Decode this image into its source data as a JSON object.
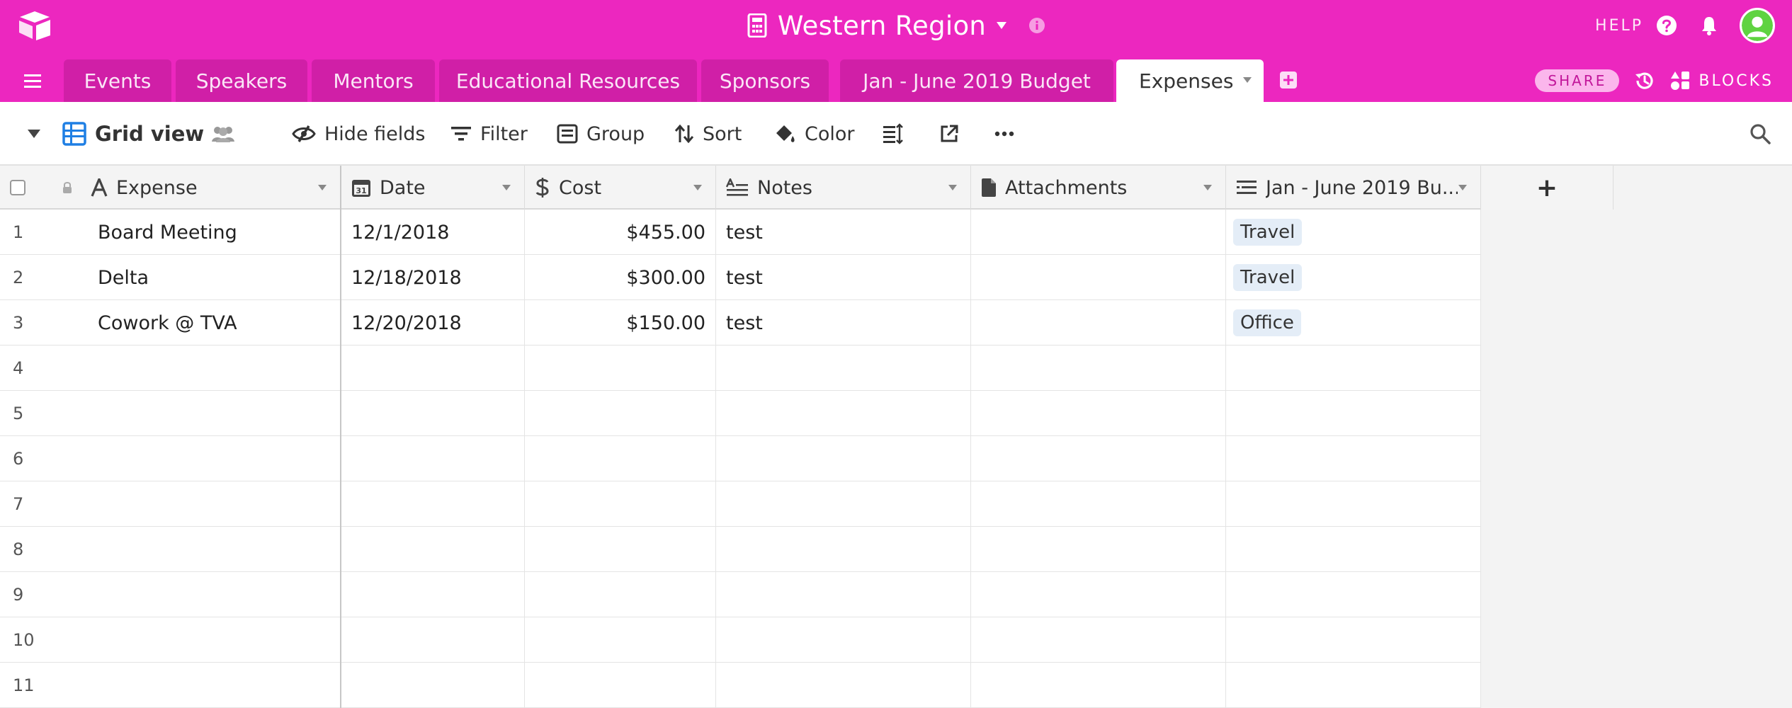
{
  "header": {
    "base_title": "Western Region",
    "help_label": "HELP"
  },
  "tabs": [
    {
      "label": "Events"
    },
    {
      "label": "Speakers"
    },
    {
      "label": "Mentors"
    },
    {
      "label": "Educational Resources"
    },
    {
      "label": "Sponsors"
    },
    {
      "label": "Jan - June 2019 Budget"
    },
    {
      "label": "Expenses"
    }
  ],
  "tab_actions": {
    "share_label": "SHARE",
    "blocks_label": "BLOCKS"
  },
  "viewbar": {
    "view_name": "Grid view",
    "hide_fields": "Hide fields",
    "filter": "Filter",
    "group": "Group",
    "sort": "Sort",
    "color": "Color"
  },
  "columns": [
    {
      "label": "Expense"
    },
    {
      "label": "Date"
    },
    {
      "label": "Cost"
    },
    {
      "label": "Notes"
    },
    {
      "label": "Attachments"
    },
    {
      "label": "Jan - June 2019 Bu..."
    }
  ],
  "add_column_label": "+",
  "rows": [
    {
      "num": "1",
      "expense": "Board Meeting",
      "date": "12/1/2018",
      "cost": "$455.00",
      "notes": "test",
      "budget": "Travel"
    },
    {
      "num": "2",
      "expense": "Delta",
      "date": "12/18/2018",
      "cost": "$300.00",
      "notes": "test",
      "budget": "Travel"
    },
    {
      "num": "3",
      "expense": "Cowork @ TVA",
      "date": "12/20/2018",
      "cost": "$150.00",
      "notes": "test",
      "budget": "Office"
    }
  ],
  "empty_rows": [
    "4",
    "5",
    "6",
    "7",
    "8",
    "9",
    "10",
    "11"
  ],
  "colors": {
    "brand": "#ec27bf",
    "tab_inactive": "#d01fa7",
    "accent_blue": "#1f7fe4",
    "avatar_green": "#5fd341"
  }
}
